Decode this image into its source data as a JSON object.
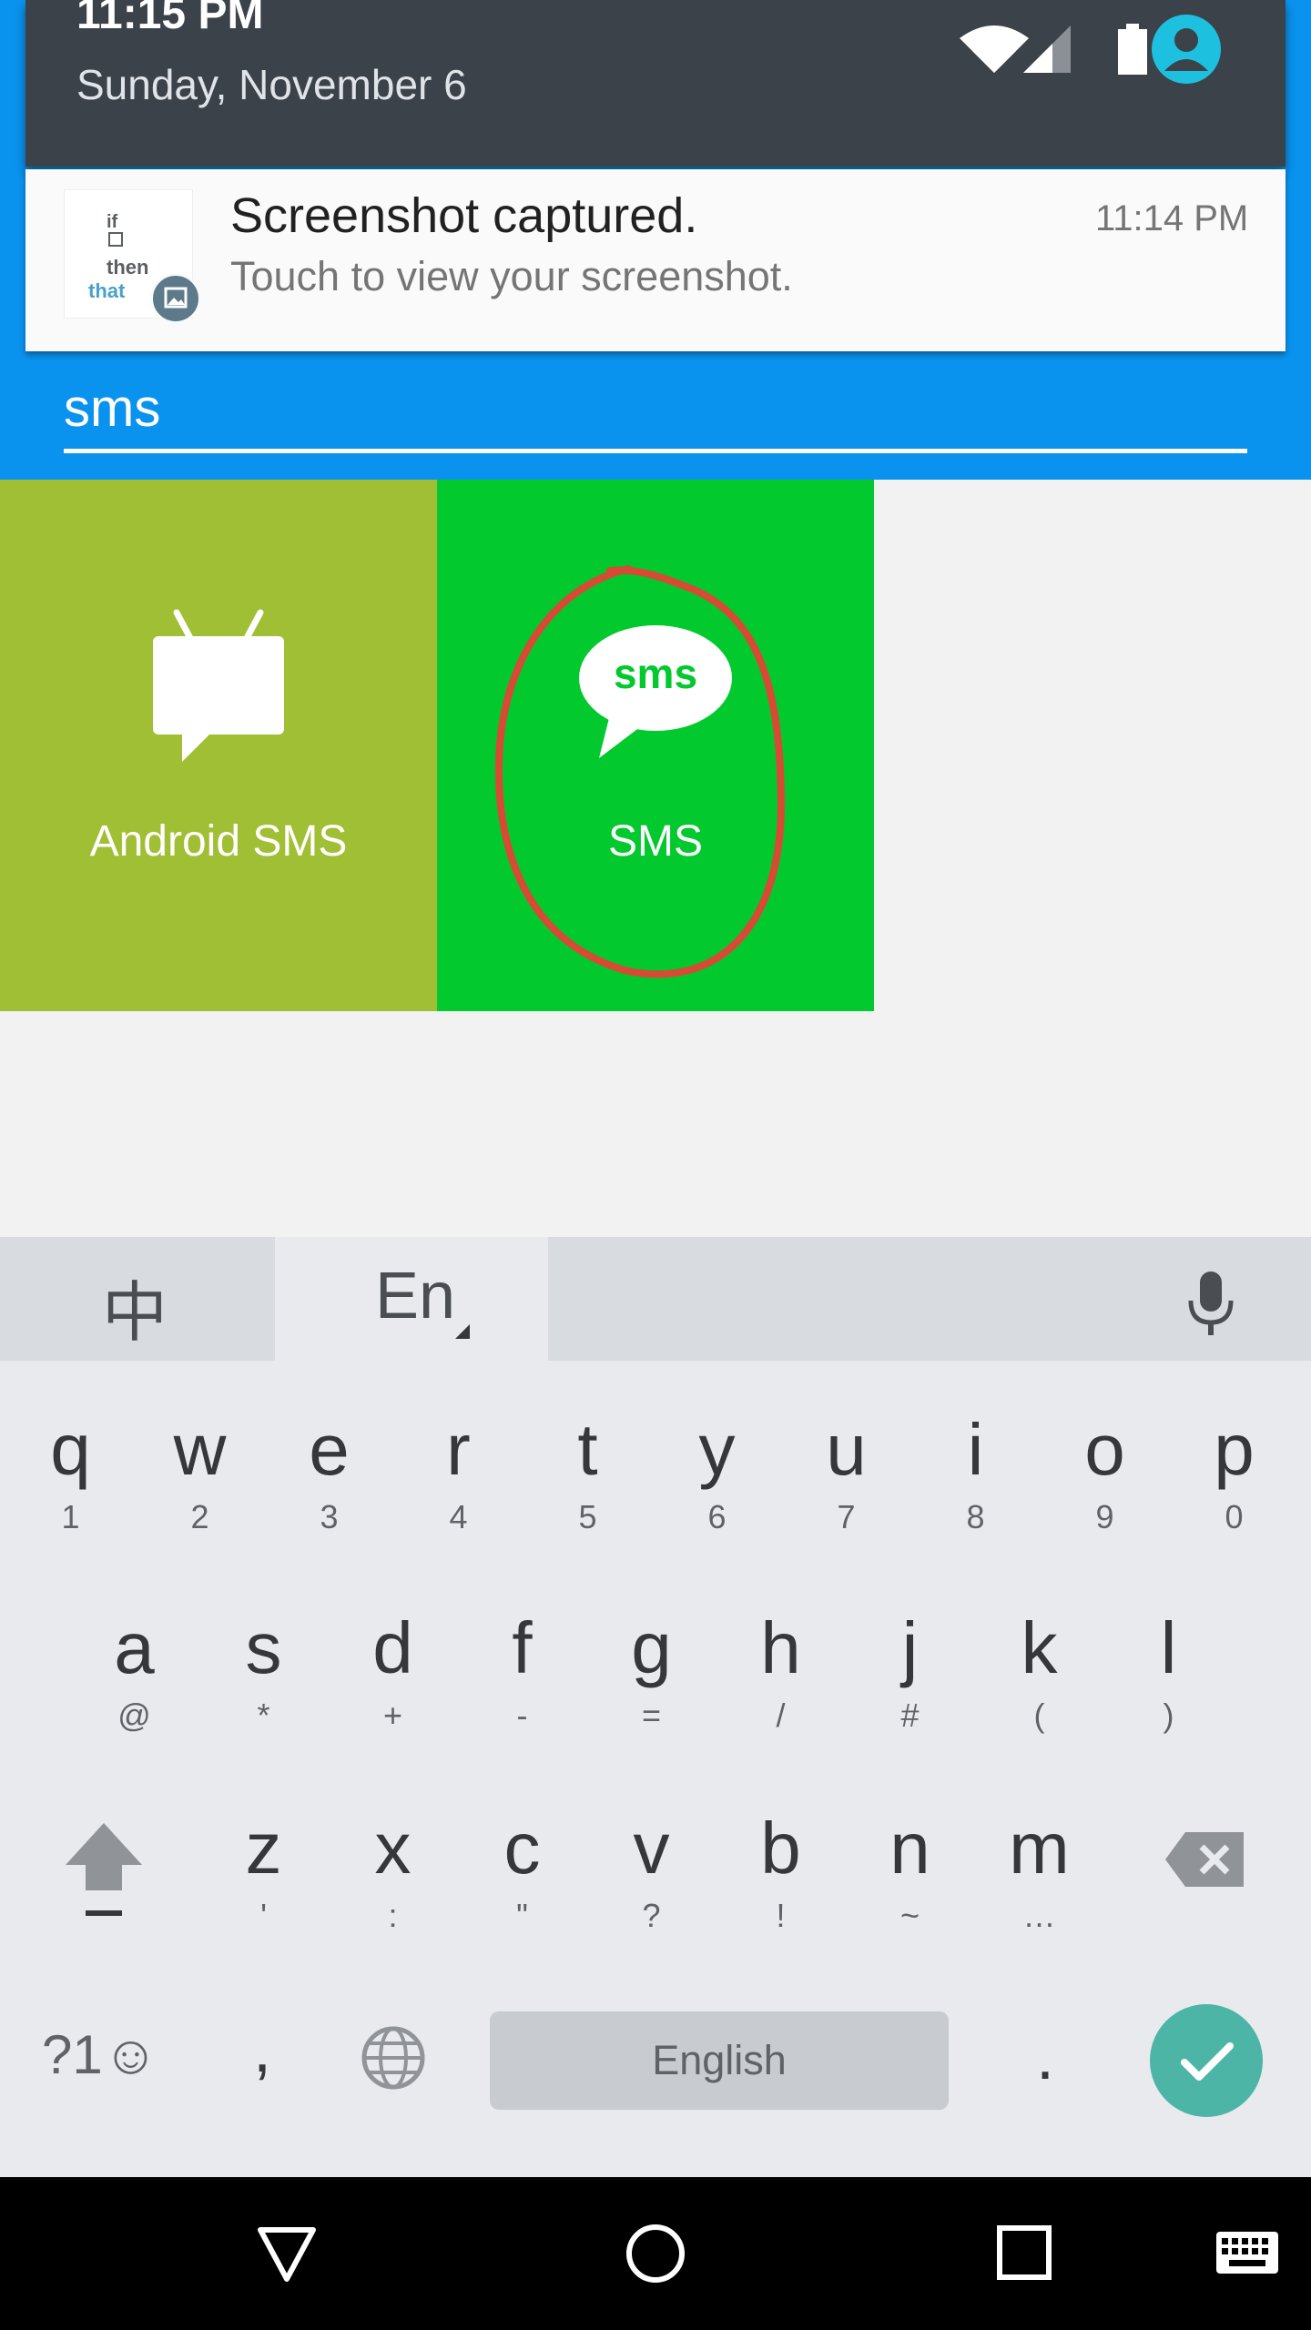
{
  "notification_shade": {
    "time": "11:15 PM",
    "date": "Sunday, November 6"
  },
  "notification": {
    "app_icon": "ifttt-logo",
    "app_logo_text": [
      "if",
      "then",
      "that"
    ],
    "title": "Screenshot captured.",
    "body": "Touch to view your screenshot.",
    "time": "11:14 PM",
    "badge_icon": "image-icon"
  },
  "search": {
    "query": "sms"
  },
  "tiles": [
    {
      "label": "Android SMS",
      "color": "#a1bf34",
      "icon": "android-tv-chat-icon"
    },
    {
      "label": "SMS",
      "color": "#02c92d",
      "icon": "sms-bubble-icon",
      "icon_text": "sms",
      "annotated": true
    }
  ],
  "keyboard": {
    "lang_tabs": [
      {
        "label": "中"
      },
      {
        "label": "En"
      }
    ],
    "rows": [
      [
        {
          "main": "q",
          "sub": "1"
        },
        {
          "main": "w",
          "sub": "2"
        },
        {
          "main": "e",
          "sub": "3"
        },
        {
          "main": "r",
          "sub": "4"
        },
        {
          "main": "t",
          "sub": "5"
        },
        {
          "main": "y",
          "sub": "6"
        },
        {
          "main": "u",
          "sub": "7"
        },
        {
          "main": "i",
          "sub": "8"
        },
        {
          "main": "o",
          "sub": "9"
        },
        {
          "main": "p",
          "sub": "0"
        }
      ],
      [
        {
          "main": "a",
          "sub": "@"
        },
        {
          "main": "s",
          "sub": "*"
        },
        {
          "main": "d",
          "sub": "+"
        },
        {
          "main": "f",
          "sub": "-"
        },
        {
          "main": "g",
          "sub": "="
        },
        {
          "main": "h",
          "sub": "/"
        },
        {
          "main": "j",
          "sub": "#"
        },
        {
          "main": "k",
          "sub": "("
        },
        {
          "main": "l",
          "sub": ")"
        }
      ],
      [
        {
          "main": "z",
          "sub": "'"
        },
        {
          "main": "x",
          "sub": ":"
        },
        {
          "main": "c",
          "sub": "\""
        },
        {
          "main": "v",
          "sub": "?"
        },
        {
          "main": "b",
          "sub": "!"
        },
        {
          "main": "n",
          "sub": "~"
        },
        {
          "main": "m",
          "sub": "…"
        }
      ]
    ],
    "symbols_label": "?1☺",
    "comma": ",",
    "space_label": "English",
    "period": ".",
    "accent_color": "#4cb5a5"
  },
  "colors": {
    "app_bar": "#0a93ee",
    "shade": "#3b4249",
    "annotation_circle": "#d84a33"
  }
}
